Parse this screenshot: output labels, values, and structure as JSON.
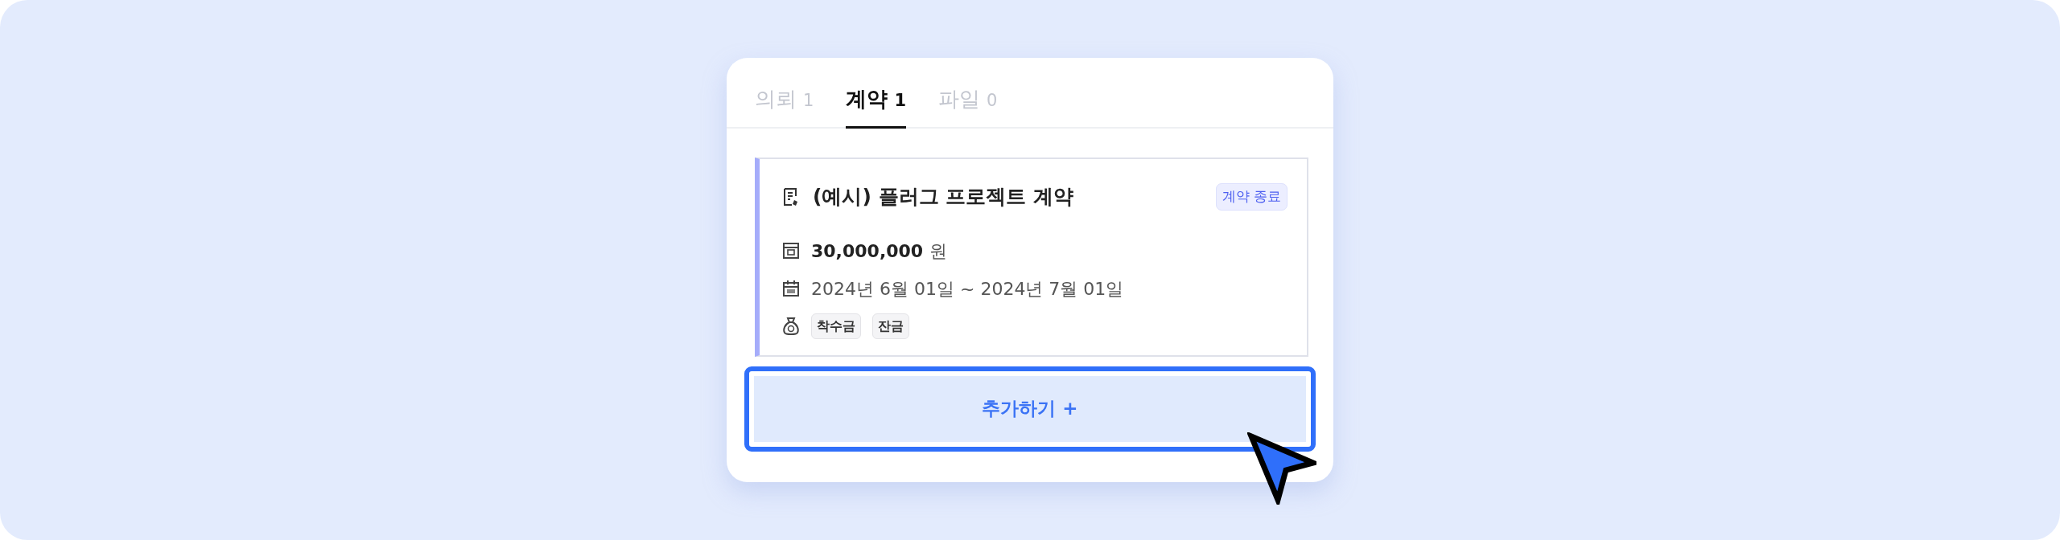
{
  "tabs": [
    {
      "label": "의뢰",
      "count": "1",
      "selected": false
    },
    {
      "label": "계약",
      "count": "1",
      "selected": true
    },
    {
      "label": "파일",
      "count": "0",
      "selected": false
    }
  ],
  "contract": {
    "title": "(예시) 플러그 프로젝트 계약",
    "status": "계약 종료",
    "amount": "30,000,000",
    "currency": "원",
    "period": "2024년 6월 01일 ~ 2024년 7월 01일",
    "payments": [
      "착수금",
      "잔금"
    ]
  },
  "add_button": {
    "label": "추가하기 +"
  }
}
